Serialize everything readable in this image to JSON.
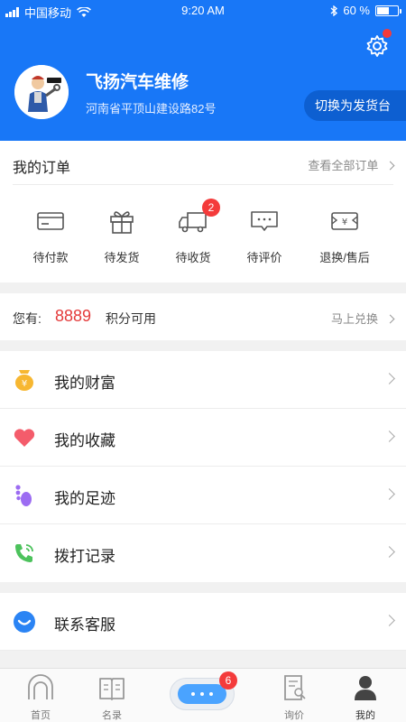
{
  "status_bar": {
    "carrier": "中国移动",
    "time": "9:20 AM",
    "battery_text": "60 %",
    "battery_level": 0.6
  },
  "header": {
    "store_name": "飞扬汽车维修",
    "address": "河南省平顶山建设路82号",
    "switch_label": "切换为发货台",
    "settings_has_notification": true
  },
  "orders": {
    "title": "我的订单",
    "view_all": "查看全部订单",
    "items": [
      {
        "label": "待付款",
        "icon": "card-icon"
      },
      {
        "label": "待发货",
        "icon": "gift-box-icon"
      },
      {
        "label": "待收货",
        "icon": "truck-icon",
        "badge": "2"
      },
      {
        "label": "待评价",
        "icon": "comment-icon"
      },
      {
        "label": "退换/售后",
        "icon": "refund-icon"
      }
    ]
  },
  "points": {
    "label": "您有:",
    "value": "8889",
    "unit": "积分可用",
    "action": "马上兑换"
  },
  "menu": [
    {
      "label": "我的财富",
      "icon": "money-bag-icon",
      "color": "#f7b731"
    },
    {
      "label": "我的收藏",
      "icon": "heart-icon",
      "color": "#f45c6b"
    },
    {
      "label": "我的足迹",
      "icon": "footprint-icon",
      "color": "#9c6cf2"
    },
    {
      "label": "拨打记录",
      "icon": "phone-icon",
      "color": "#4cc25c"
    }
  ],
  "service": {
    "label": "联系客服",
    "icon": "chat-bubble-icon",
    "color": "#2b84f4"
  },
  "tabbar": {
    "items": [
      {
        "label": "首页",
        "icon": "home-icon"
      },
      {
        "label": "名录",
        "icon": "book-icon"
      },
      {
        "label": "询价",
        "icon": "inquiry-icon"
      },
      {
        "label": "我的",
        "icon": "user-icon",
        "active": true
      }
    ],
    "chat_badge": "6"
  },
  "colors": {
    "primary": "#1877f7",
    "badge": "#f43b3b",
    "points": "#e43a3a"
  }
}
